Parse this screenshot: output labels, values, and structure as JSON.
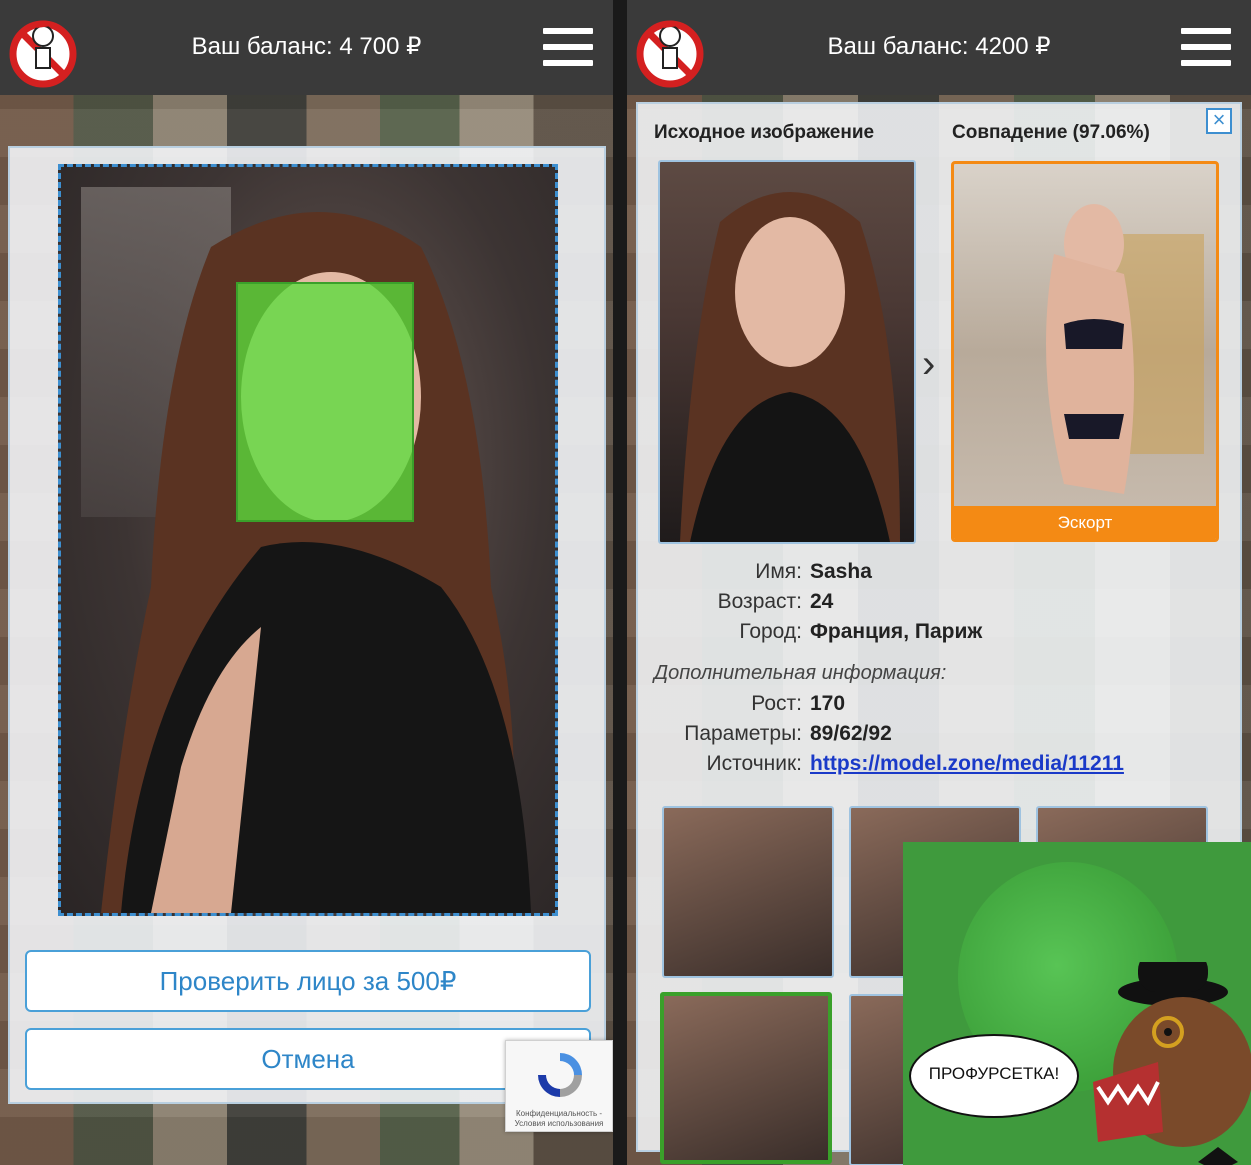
{
  "left_screen": {
    "header": {
      "balance": "Ваш баланс: 4 700 ₽"
    },
    "buttons": {
      "check_face": "Проверить лицо за 500₽",
      "cancel": "Отмена"
    },
    "recaptcha": {
      "text": "Конфиденциальность - Условия использования"
    }
  },
  "right_screen": {
    "header": {
      "balance": "Ваш баланс: 4200 ₽"
    },
    "titles": {
      "source": "Исходное изображение",
      "match": "Совпадение (97.06%)"
    },
    "match_label": "Эскорт",
    "close": "×",
    "profile": {
      "name_label": "Имя:",
      "name": "Sasha",
      "age_label": "Возраст:",
      "age": "24",
      "city_label": "Город:",
      "city": "Франция, Париж",
      "extra_label": "Дополнительная информация:",
      "height_label": "Рост:",
      "height": "170",
      "params_label": "Параметры:",
      "params": "89/62/92",
      "source_label": "Источник:",
      "source": "https://model.zone/media/11211"
    }
  },
  "meme": {
    "bubble": "ПРОФУРСЕТКА!"
  },
  "colors": {
    "accent": "#3d8fd0",
    "match_orange": "#f48a14",
    "face_green": "#5adc3c",
    "link": "#1a3ac8"
  }
}
